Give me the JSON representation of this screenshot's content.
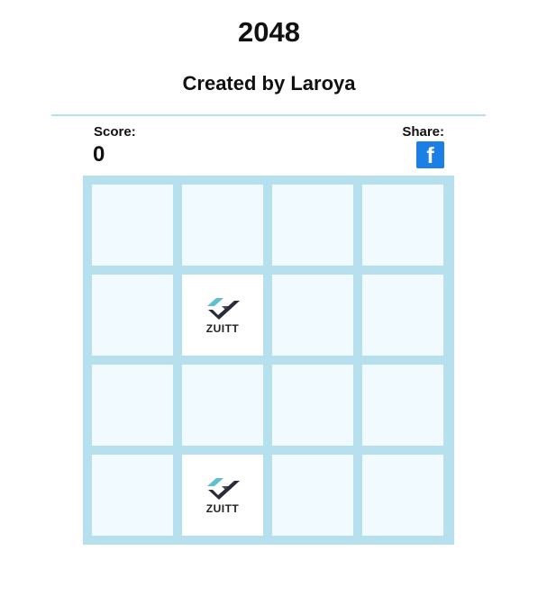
{
  "header": {
    "title": "2048",
    "subtitle": "Created by Laroya"
  },
  "score": {
    "label": "Score:",
    "value": "0"
  },
  "share": {
    "label": "Share:",
    "facebook_glyph": "f",
    "facebook_icon": "facebook-icon",
    "facebook_color": "#1c7fe6"
  },
  "board": {
    "rows": 4,
    "cols": 4,
    "tile_text": "ZUITT",
    "tile_icon": "zuitt-logo-icon",
    "cells": [
      [
        "",
        "",
        "",
        ""
      ],
      [
        "",
        "ZUITT",
        "",
        ""
      ],
      [
        "",
        "",
        "",
        ""
      ],
      [
        "",
        "ZUITT",
        "",
        ""
      ]
    ]
  },
  "colors": {
    "board_border": "#b7e0ef",
    "empty_cell": "#f0faff",
    "divider": "#b5def0",
    "logo_teal": "#5fc1cf",
    "logo_dark": "#2b2c3a"
  }
}
